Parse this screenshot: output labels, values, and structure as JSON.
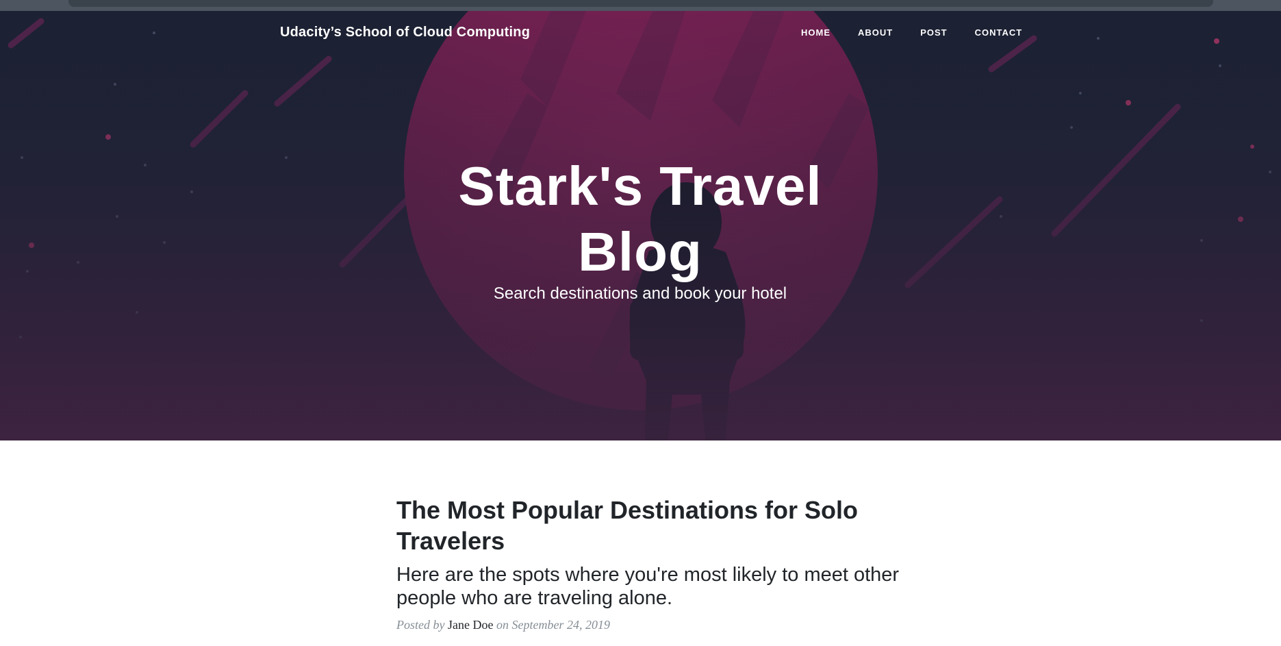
{
  "navbar": {
    "brand": "Udacity’s School of Cloud Computing",
    "links": [
      {
        "label": "HOME"
      },
      {
        "label": "ABOUT"
      },
      {
        "label": "POST"
      },
      {
        "label": "CONTACT"
      }
    ]
  },
  "hero": {
    "title_line1": "Stark's Travel",
    "title_line2": "Blog",
    "subtitle": "Search destinations and book your hotel"
  },
  "post_preview": {
    "title_line1": "The Most Popular Destinations for Solo",
    "title_line2": "Travelers",
    "subtitle_line1": "Here are the spots where you're most likely to meet other",
    "subtitle_line2": "people who are traveling alone.",
    "meta_posted_by": "Posted by",
    "author": "Jane Doe",
    "meta_on": "on September 24, 2019"
  },
  "colors": {
    "hero_bg": "#1c2133",
    "planet": "#7a2150",
    "accent_pink": "#c0396f",
    "text_dark": "#212529",
    "text_muted": "#868e96"
  }
}
